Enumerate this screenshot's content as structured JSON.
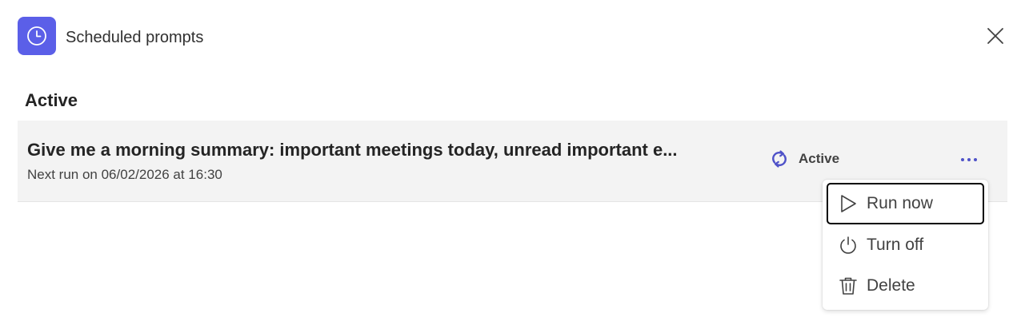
{
  "header": {
    "title": "Scheduled prompts",
    "icon": "clock-icon",
    "icon_bg": "#5b5fe8"
  },
  "close": {
    "icon": "close-icon"
  },
  "section": {
    "heading": "Active"
  },
  "prompt": {
    "title": "Give me a morning summary: important meetings today, unread important e...",
    "next_run": "Next run on 06/02/2026 at 16:30",
    "status_label": "Active",
    "status_icon": "recurring-icon",
    "status_color": "#4f52c8",
    "more_icon": "more-icon"
  },
  "menu": {
    "items": [
      {
        "label": "Run now",
        "icon": "play-icon"
      },
      {
        "label": "Turn off",
        "icon": "power-icon"
      },
      {
        "label": "Delete",
        "icon": "trash-icon"
      }
    ]
  }
}
